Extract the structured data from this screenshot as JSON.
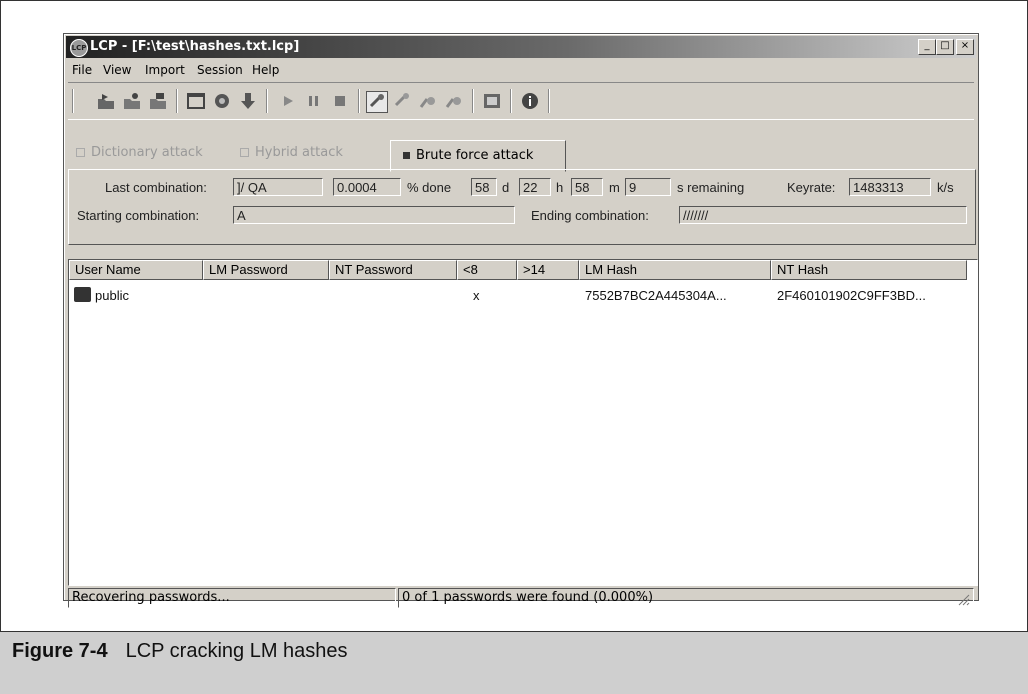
{
  "window": {
    "title": "LCP - [F:\\test\\hashes.txt.lcp]",
    "app_icon": "lcp-app-icon",
    "controls": {
      "minimize": "_",
      "maximize": "□",
      "close": "×"
    }
  },
  "menu": [
    "File",
    "View",
    "Import",
    "Session",
    "Help"
  ],
  "toolbar_icons": [
    "open-icon",
    "import-icon",
    "import-remote-icon",
    "new-session-icon",
    "globe-icon",
    "download-icon",
    "play-icon",
    "pause-icon",
    "stop-icon",
    "lm-key-icon",
    "nt-key-icon",
    "lm-users-icon",
    "nt-users-icon",
    "report-icon",
    "about-icon"
  ],
  "tabs": {
    "dictionary": "Dictionary attack",
    "hybrid": "Hybrid attack",
    "brute": "Brute force attack"
  },
  "brute": {
    "last_combination_label": "Last combination:",
    "last_combination": "]/ QA",
    "percent": "0.0004",
    "percent_label": "% done",
    "days": "58",
    "days_label": "d",
    "hours": "22",
    "hours_label": "h",
    "minutes": "58",
    "minutes_label": "m",
    "seconds": "9",
    "seconds_label": "s remaining",
    "keyrate_label": "Keyrate:",
    "keyrate": "1483313",
    "keyrate_unit": "k/s",
    "starting_label": "Starting combination:",
    "starting": "A",
    "ending_label": "Ending combination:",
    "ending": "///////"
  },
  "table": {
    "columns": [
      "User Name",
      "LM Password",
      "NT Password",
      "<8",
      ">14",
      "LM Hash",
      "NT Hash"
    ],
    "rows": [
      {
        "user": "public",
        "lm_password": "",
        "nt_password": "",
        "lt8": "x",
        "gt14": "",
        "lm_hash": "7552B7BC2A445304A...",
        "nt_hash": "2F460101902C9FF3BD..."
      }
    ]
  },
  "status": {
    "left": "Recovering passwords...",
    "right": "0 of 1 passwords were found (0.000%)"
  },
  "figure": {
    "label": "Figure 7-4",
    "caption": "LCP cracking LM hashes"
  }
}
